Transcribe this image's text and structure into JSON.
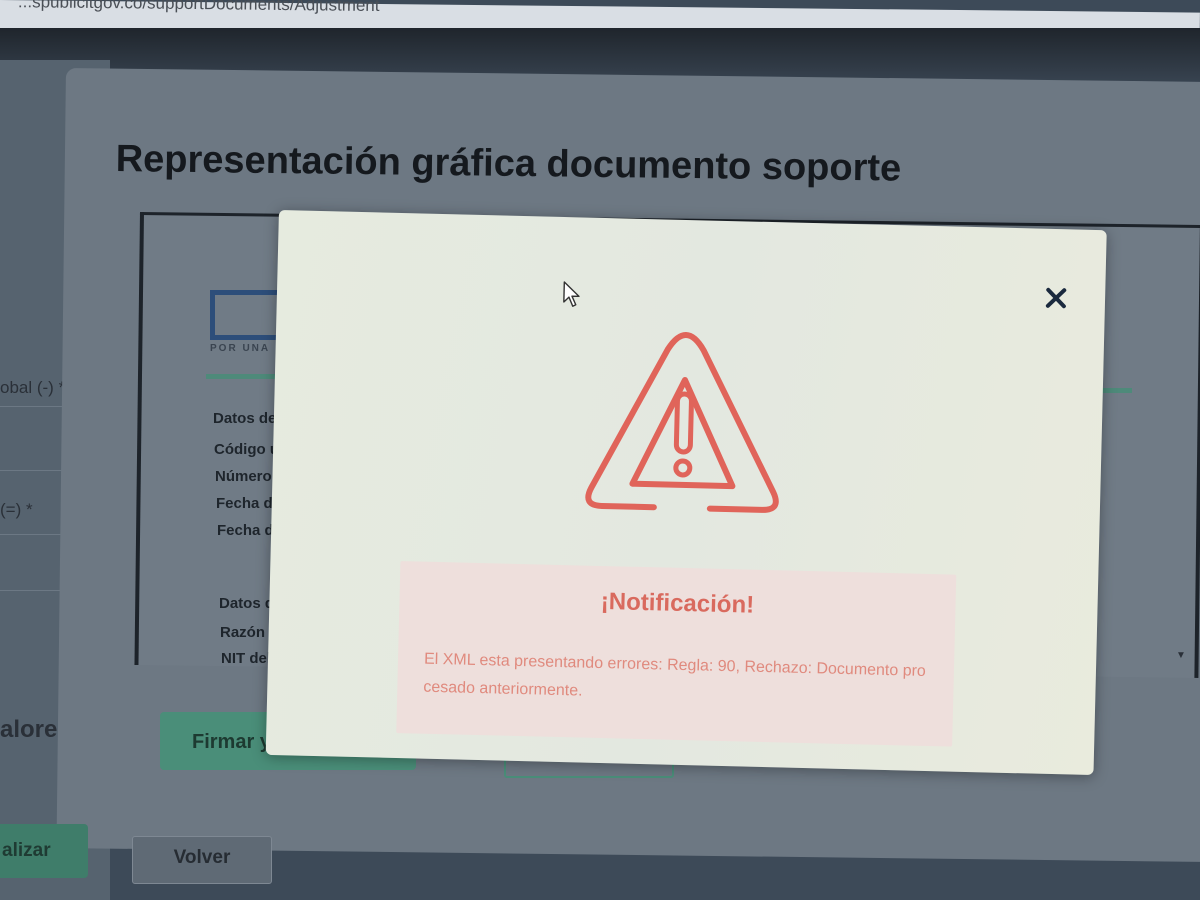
{
  "browser": {
    "url": "...spublicitgov.co/supportDocuments/Adjustment"
  },
  "background_page": {
    "side_labels": [
      "obal (-) *",
      "(=) *"
    ],
    "section_label": "alores",
    "finalize_button": "alizar",
    "back_button": "Volver"
  },
  "preview": {
    "title": "Representación gráfica documento soporte",
    "logo_subtitle": "POR UNA",
    "fields": [
      "Datos de",
      "Código ú",
      "Número",
      "Fecha de",
      "Fecha de",
      "Datos de",
      "Razón so",
      "NIT del"
    ],
    "sign_button": "Firmar y"
  },
  "modal": {
    "title": "¡Notificación!",
    "message": "El XML esta presentando errores: Regla: 90, Rechazo: Documento procesado anteriormente.",
    "icon": "warning-triangle-icon",
    "close_icon": "close-icon",
    "colors": {
      "accent": "#e0645a",
      "background": "#e6ebdf",
      "message_box": "#eedfdc"
    }
  }
}
